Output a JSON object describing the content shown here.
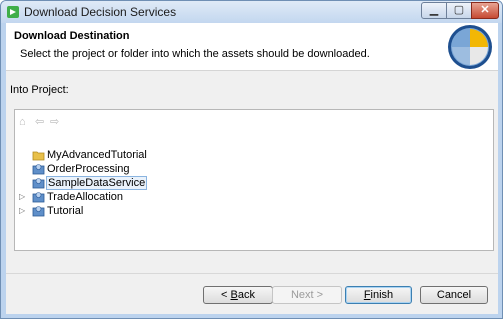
{
  "window": {
    "title": "Download Decision Services"
  },
  "banner": {
    "title": "Download Destination",
    "description": "Select the project or folder into which the assets should be downloaded."
  },
  "into_project_label": "Into Project:",
  "tree": {
    "items": [
      {
        "label": "MyAdvancedTutorial",
        "icon": "folder-icon",
        "expandable": false,
        "selected": false
      },
      {
        "label": "OrderProcessing",
        "icon": "project-icon",
        "expandable": false,
        "selected": false
      },
      {
        "label": "SampleDataService",
        "icon": "project-icon",
        "expandable": false,
        "selected": true
      },
      {
        "label": "TradeAllocation",
        "icon": "project-icon",
        "expandable": true,
        "selected": false
      },
      {
        "label": "Tutorial",
        "icon": "project-icon",
        "expandable": true,
        "selected": false
      }
    ]
  },
  "buttons": {
    "back_prefix": "< ",
    "back_mnemonic": "B",
    "back_rest": "ack",
    "next": "Next >",
    "finish_mnemonic": "F",
    "finish_rest": "inish",
    "cancel": "Cancel"
  },
  "colors": {
    "selection_border": "#8ab4e0",
    "window_frame": "#bcd3ee"
  }
}
